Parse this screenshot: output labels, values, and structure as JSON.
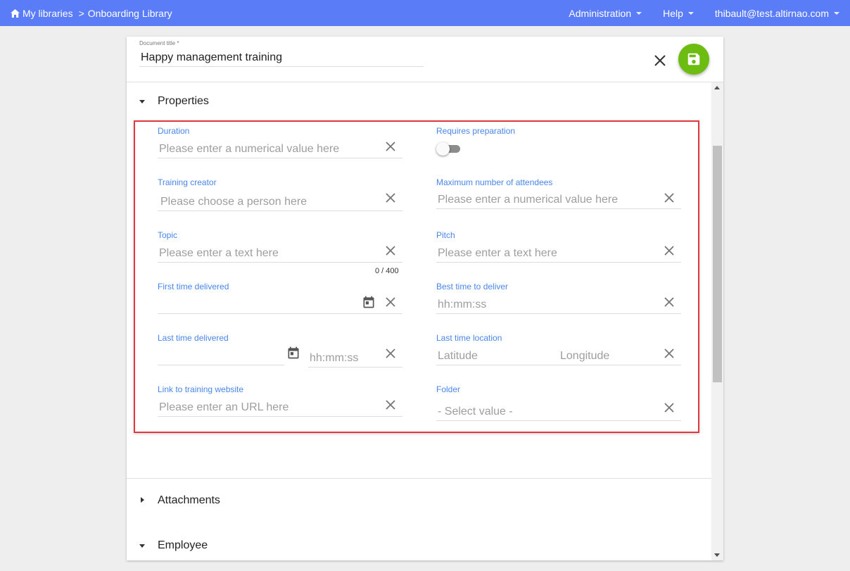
{
  "topbar": {
    "breadcrumb": {
      "home_label": "My libraries",
      "separator": ">",
      "current": "Onboarding Library"
    },
    "menu": {
      "administration": "Administration",
      "help": "Help",
      "user": "thibault@test.altirnao.com"
    }
  },
  "document": {
    "title_label": "Document title *",
    "title_value": "Happy management training"
  },
  "sections": {
    "properties": "Properties",
    "attachments": "Attachments",
    "employee": "Employee"
  },
  "form": {
    "duration": {
      "label": "Duration",
      "placeholder": "Please enter a numerical value here"
    },
    "requires_preparation": {
      "label": "Requires preparation",
      "checked": false
    },
    "training_creator": {
      "label": "Training creator",
      "placeholder": "Please choose a person here"
    },
    "max_attendees": {
      "label": "Maximum number of attendees",
      "placeholder": "Please enter a numerical value here"
    },
    "topic": {
      "label": "Topic",
      "placeholder": "Please enter a text here",
      "counter": "0 / 400"
    },
    "pitch": {
      "label": "Pitch",
      "placeholder": "Please enter a text here"
    },
    "first_time_delivered": {
      "label": "First time delivered"
    },
    "best_time": {
      "label": "Best time to deliver",
      "placeholder": "hh:mm:ss"
    },
    "last_time_delivered": {
      "label": "Last time delivered",
      "time_placeholder": "hh:mm:ss"
    },
    "last_time_location": {
      "label": "Last time location",
      "lat_placeholder": "Latitude",
      "lng_placeholder": "Longitude"
    },
    "link": {
      "label": "Link to training website",
      "placeholder": "Please enter an URL here"
    },
    "folder": {
      "label": "Folder",
      "placeholder": "- Select value -"
    }
  },
  "colors": {
    "topbar": "#5b7cf7",
    "label": "#4a86e8",
    "save": "#6cbc12",
    "highlight": "#e0383e"
  },
  "icons": [
    "home-icon",
    "caret-down-icon",
    "close-icon",
    "save-icon",
    "calendar-icon",
    "clear-icon",
    "triangle-down-icon",
    "triangle-right-icon"
  ]
}
